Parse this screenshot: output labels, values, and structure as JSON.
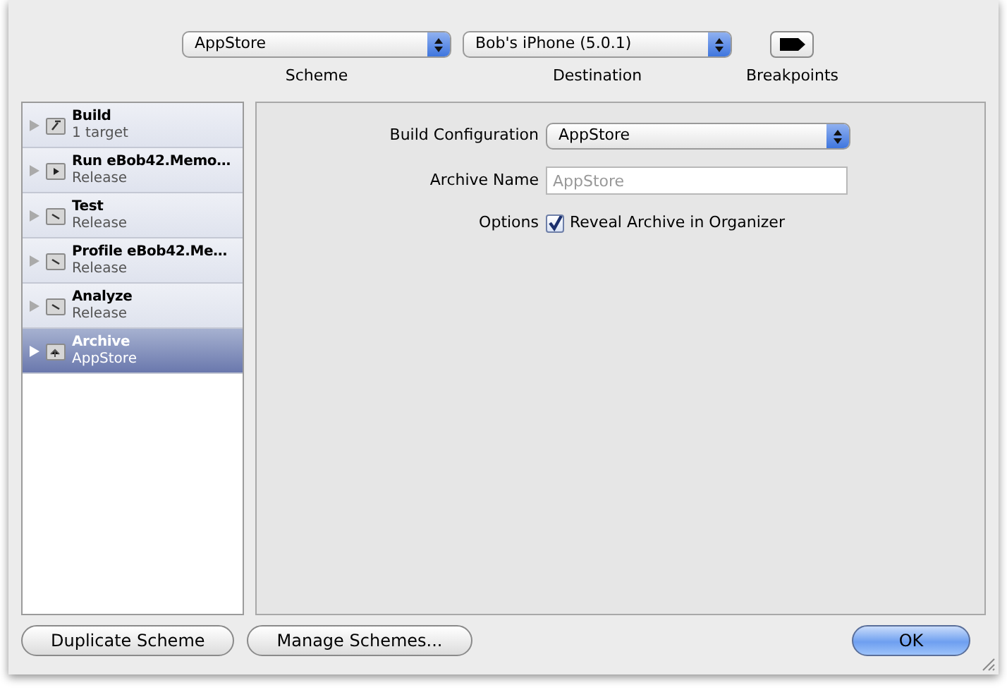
{
  "toolbar": {
    "scheme": {
      "value": "AppStore",
      "label": "Scheme"
    },
    "destination": {
      "value": "Bob's iPhone (5.0.1)",
      "label": "Destination"
    },
    "breakpoints": {
      "label": "Breakpoints",
      "on": true
    }
  },
  "actions": [
    {
      "title": "Build",
      "subtitle": "1 target",
      "kind": "hammer",
      "selected": false
    },
    {
      "title": "Run eBob42.Memo…",
      "subtitle": "Release",
      "kind": "play",
      "selected": false
    },
    {
      "title": "Test",
      "subtitle": "Release",
      "kind": "wrench",
      "selected": false
    },
    {
      "title": "Profile eBob42.Me…",
      "subtitle": "Release",
      "kind": "wrench",
      "selected": false
    },
    {
      "title": "Analyze",
      "subtitle": "Release",
      "kind": "wrench",
      "selected": false
    },
    {
      "title": "Archive",
      "subtitle": "AppStore",
      "kind": "archive",
      "selected": true
    }
  ],
  "form": {
    "build_configuration": {
      "label": "Build Configuration",
      "value": "AppStore"
    },
    "archive_name": {
      "label": "Archive Name",
      "placeholder": "AppStore"
    },
    "options": {
      "label": "Options",
      "checkbox": "Reveal Archive in Organizer",
      "checked": true
    }
  },
  "buttons": [
    {
      "label": "Duplicate Scheme",
      "kind": "plain"
    },
    {
      "label": "Manage Schemes...",
      "kind": "plain"
    },
    {
      "label": "OK",
      "kind": "default"
    }
  ]
}
